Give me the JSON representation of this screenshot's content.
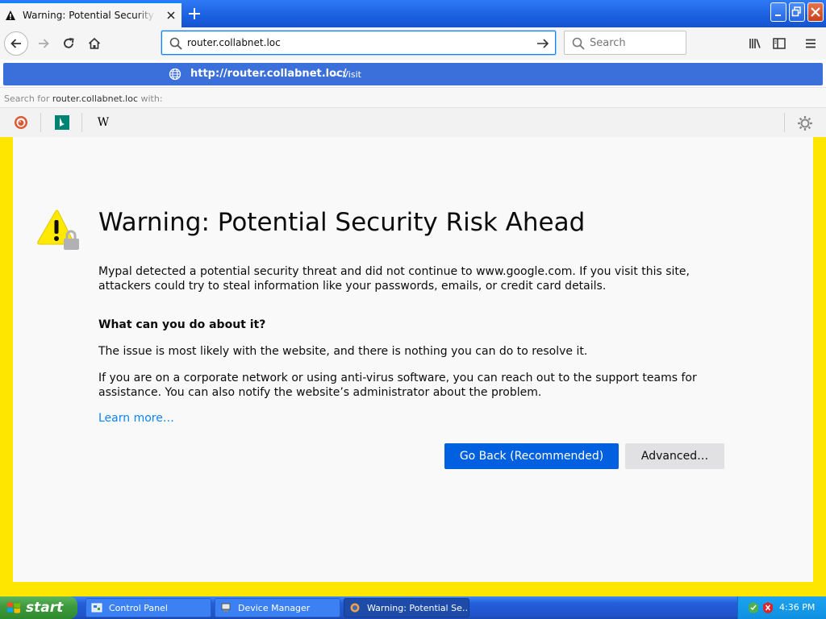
{
  "browser": {
    "tab_title": "Warning: Potential Security Risk Ahead",
    "url_input": "router.collabnet.loc",
    "search_placeholder": "Search"
  },
  "dropdown": {
    "suggestion_url": "http://router.collabnet.loc/",
    "suggestion_action": "— Visit",
    "search_for_prefix": "Search for",
    "search_for_term": "router.collabnet.loc",
    "search_for_suffix": "with:",
    "engines": [
      "duckduckgo-icon",
      "bing-icon",
      "wikipedia-icon"
    ],
    "wiki_glyph": "W"
  },
  "page": {
    "title": "Warning: Potential Security Risk Ahead",
    "intro": "Mypal detected a potential security threat and did not continue to www.google.com. If you visit this site, attackers could try to steal information like your passwords, emails, or credit card details.",
    "what_heading": "What can you do about it?",
    "issue": "The issue is most likely with the website, and there is nothing you can do to resolve it.",
    "corp": "If you are on a corporate network or using anti-virus software, you can reach out to the support teams for assistance. You can also notify the website’s administrator about the problem.",
    "learn_more": "Learn more…",
    "go_back": "Go Back (Recommended)",
    "advanced": "Advanced…"
  },
  "taskbar": {
    "start": "start",
    "tasks": [
      "Control Panel",
      "Device Manager",
      "Warning: Potential Se…"
    ],
    "clock": "4:36 PM"
  },
  "colors": {
    "accent": "#0a84ff",
    "primary_button": "#0060df",
    "frame": "#ffe600",
    "warning": "#ffe900"
  }
}
